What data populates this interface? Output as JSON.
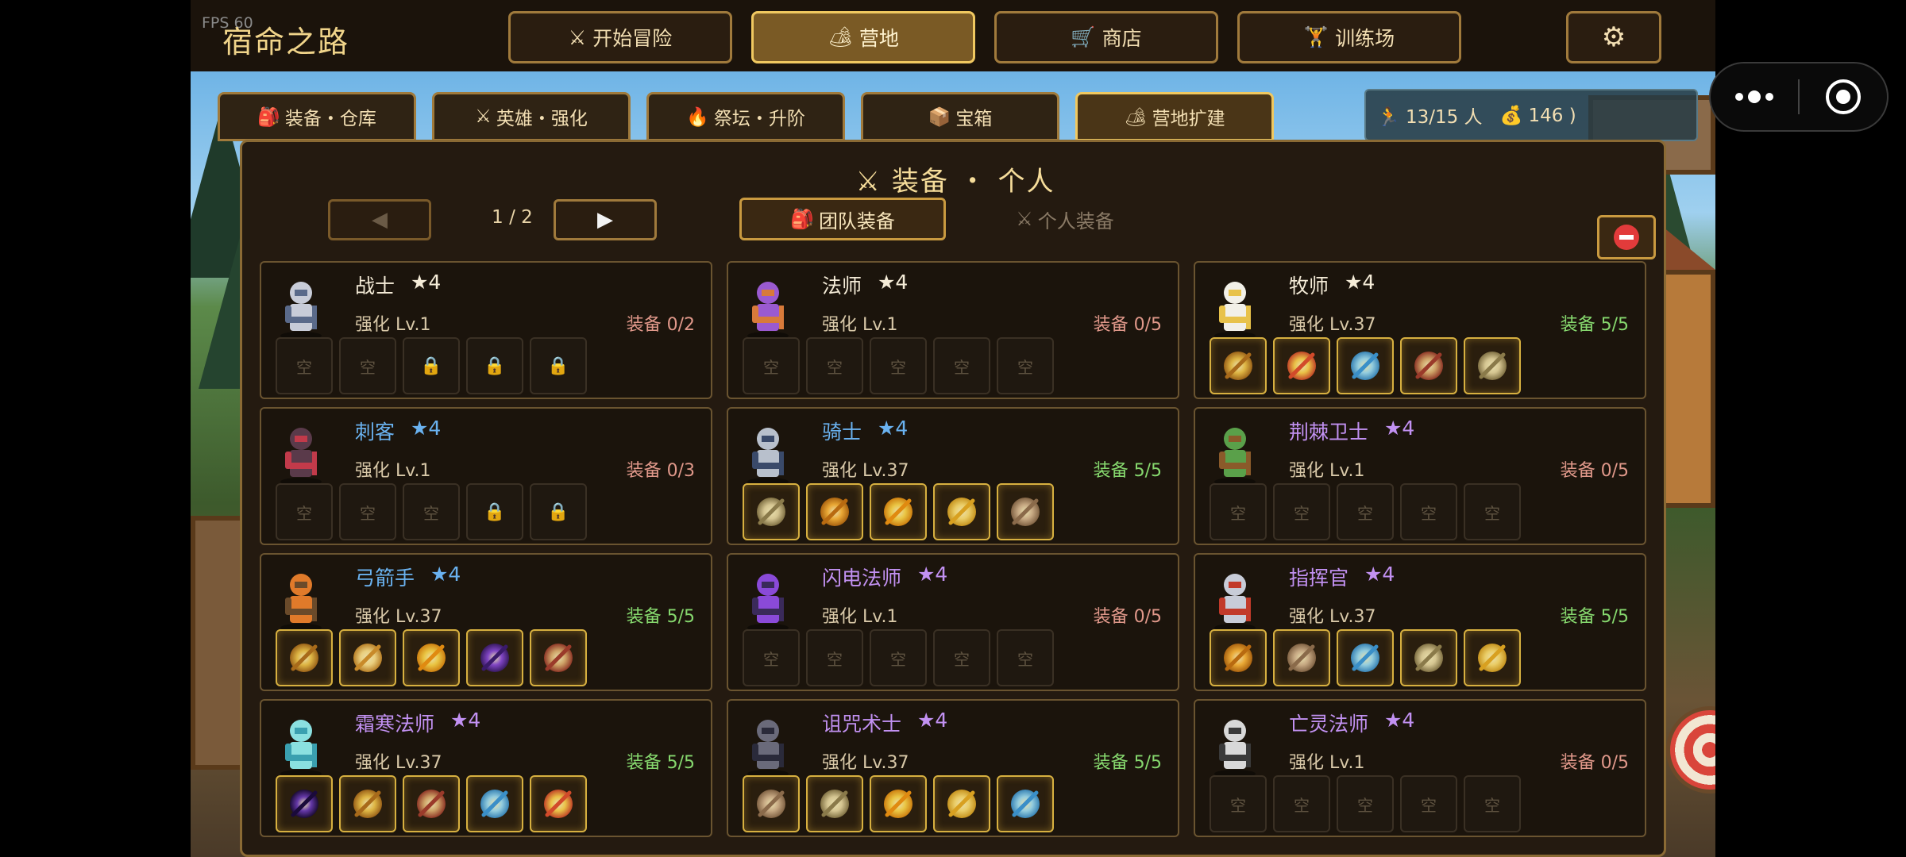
{
  "fps": "FPS 60",
  "title": "宿命之路",
  "nav": [
    {
      "icon": "⚔",
      "label": "开始冒险"
    },
    {
      "icon": "🏕",
      "label": "营地"
    },
    {
      "icon": "🛒",
      "label": "商店"
    },
    {
      "icon": "🏋",
      "label": "训练场"
    }
  ],
  "settings_icon": "⚙",
  "subtabs": [
    {
      "icon": "🎒",
      "label": "装备・仓库"
    },
    {
      "icon": "⚔",
      "label": "英雄・强化"
    },
    {
      "icon": "🔥",
      "label": "祭坛・升阶"
    },
    {
      "icon": "📦",
      "label": "宝箱"
    },
    {
      "icon": "🏕",
      "label": "营地扩建"
    }
  ],
  "stats": {
    "population_icon": "🏃",
    "population": "13/15 人",
    "gold_icon": "💰",
    "gold": "146 )"
  },
  "panel": {
    "title": "⚔ 装备 ・ 个人",
    "prev": "◀",
    "next": "▶",
    "page": "1 / 2",
    "team_icon": "🎒",
    "team_label": "团队装备",
    "personal_icon": "⚔",
    "personal_label": "个人装备"
  },
  "colors": {
    "white": "#f5ecd8",
    "blue": "#6ab2f0",
    "purple": "#c291f2",
    "equip_incomplete": "#e0988a",
    "equip_complete": "#86d86e"
  },
  "heroes": [
    {
      "name": "战士",
      "star": "★4",
      "rarity": "white",
      "level": "强化 Lv.1",
      "equip": "装备 0/2",
      "complete": false,
      "slots": [
        "空",
        "空",
        "🔒",
        "🔒",
        "🔒"
      ],
      "avatar": "warrior"
    },
    {
      "name": "法师",
      "star": "★4",
      "rarity": "white",
      "level": "强化 Lv.1",
      "equip": "装备 0/5",
      "complete": false,
      "slots": [
        "空",
        "空",
        "空",
        "空",
        "空"
      ],
      "avatar": "mage"
    },
    {
      "name": "牧师",
      "star": "★4",
      "rarity": "white",
      "level": "强化 Lv.37",
      "equip": "装备 5/5",
      "complete": true,
      "slots": [
        "item:staff",
        "item:crown",
        "item:orb",
        "item:dagger",
        "item:amulet"
      ],
      "avatar": "priest"
    },
    {
      "name": "刺客",
      "star": "★4",
      "rarity": "blue",
      "level": "强化 Lv.1",
      "equip": "装备 0/3",
      "complete": false,
      "slots": [
        "空",
        "空",
        "空",
        "🔒",
        "🔒"
      ],
      "avatar": "assassin"
    },
    {
      "name": "骑士",
      "star": "★4",
      "rarity": "blue",
      "level": "强化 Lv.37",
      "equip": "装备 5/5",
      "complete": true,
      "slots": [
        "item:amulet",
        "item:chest",
        "item:sun",
        "item:potion",
        "item:boots"
      ],
      "avatar": "knight"
    },
    {
      "name": "荆棘卫士",
      "star": "★4",
      "rarity": "purple",
      "level": "强化 Lv.1",
      "equip": "装备 0/5",
      "complete": false,
      "slots": [
        "空",
        "空",
        "空",
        "空",
        "空"
      ],
      "avatar": "thorn"
    },
    {
      "name": "弓箭手",
      "star": "★4",
      "rarity": "blue",
      "level": "强化 Lv.37",
      "equip": "装备 5/5",
      "complete": true,
      "slots": [
        "item:staff",
        "item:feather",
        "item:sun",
        "item:wand",
        "item:dagger"
      ],
      "avatar": "archer"
    },
    {
      "name": "闪电法师",
      "star": "★4",
      "rarity": "purple",
      "level": "强化 Lv.1",
      "equip": "装备 0/5",
      "complete": false,
      "slots": [
        "空",
        "空",
        "空",
        "空",
        "空"
      ],
      "avatar": "lightning"
    },
    {
      "name": "指挥官",
      "star": "★4",
      "rarity": "purple",
      "level": "强化 Lv.37",
      "equip": "装备 5/5",
      "complete": true,
      "slots": [
        "item:chest",
        "item:boots",
        "item:orb",
        "item:amulet",
        "item:potion"
      ],
      "avatar": "commander"
    },
    {
      "name": "霜寒法师",
      "star": "★4",
      "rarity": "purple",
      "level": "强化 Lv.37",
      "equip": "装备 5/5",
      "complete": true,
      "slots": [
        "item:void",
        "item:staff",
        "item:dagger",
        "item:orb",
        "item:crown"
      ],
      "avatar": "frost"
    },
    {
      "name": "诅咒术士",
      "star": "★4",
      "rarity": "purple",
      "level": "强化 Lv.37",
      "equip": "装备 5/5",
      "complete": true,
      "slots": [
        "item:boots",
        "item:amulet",
        "item:sun",
        "item:potion",
        "item:orb"
      ],
      "avatar": "warlock"
    },
    {
      "name": "亡灵法师",
      "star": "★4",
      "rarity": "purple",
      "level": "强化 Lv.1",
      "equip": "装备 0/5",
      "complete": false,
      "slots": [
        "空",
        "空",
        "空",
        "空",
        "空"
      ],
      "avatar": "necro"
    }
  ]
}
